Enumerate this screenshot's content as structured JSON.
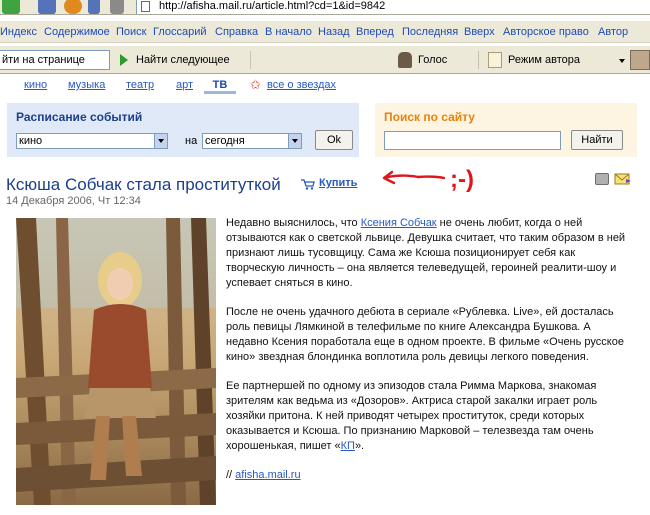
{
  "browser": {
    "url": "http://afisha.mail.ru/article.html?cd=1&id=9842",
    "links": [
      "Индекс",
      "Содержимое",
      "Поиск",
      "Глоссарий",
      "Справка",
      "В начало",
      "Назад",
      "Вперед",
      "Последняя",
      "Вверх",
      "Авторское право",
      "Автор"
    ],
    "find_placeholder": "йти на странице",
    "find_next": "Найти следующее",
    "voice": "Голос",
    "author_mode": "Режим автора"
  },
  "nav": {
    "items": [
      "кино",
      "музыка",
      "театр",
      "арт"
    ],
    "active": "ТВ",
    "stars": "все о звездах"
  },
  "schedule": {
    "title": "Расписание событий",
    "category": "кино",
    "on_label": "на",
    "date": "сегодня",
    "ok": "Ok"
  },
  "search": {
    "title": "Поиск по сайту",
    "button": "Найти"
  },
  "article": {
    "title": "Ксюша Собчак стала проституткой",
    "buy": "Купить",
    "date": "14 Декабря 2006, Чт 12:34",
    "p1_a": "Недавно выяснилось, что ",
    "p1_link": "Ксения Собчак",
    "p1_b": " не очень любит, когда о ней отзываются как о светской львице. Девушка считает, что таким образом в ней признают лишь тусовщицу. Сама же Ксюша позиционирует себя как творческую личность – она является телеведущей, героиней реалити-шоу и успевает сняться в кино.",
    "p2": "После не очень удачного дебюта в сериале «Рублевка. Live», ей досталась роль певицы Лямкиной в телефильме по книге Александра Бушкова. А недавно Ксения поработала еще в одном проекте. В фильме «Очень русское кино» звездная блондинка воплотила роль девицы легкого поведения.",
    "p3_a": "Ее партнершей по одному из эпизодов стала Римма Маркова, знакомая зрителям как ведьма из «Дозоров». Актриса старой закалки играет роль хозяйки притона. К ней приводят четырех проституток, среди которых оказывается и Ксюша. По признанию Марковой – телезвезда там очень хорошенькая, пишет «",
    "p3_link": "КП",
    "p3_b": "».",
    "source_prefix": "// ",
    "source_link": "afisha.mail.ru"
  },
  "annotation": ";-)",
  "colors": {
    "link": "#2659c3",
    "headline": "#1c3f8a",
    "search_title": "#e8820c",
    "annotation": "#e0151b"
  }
}
